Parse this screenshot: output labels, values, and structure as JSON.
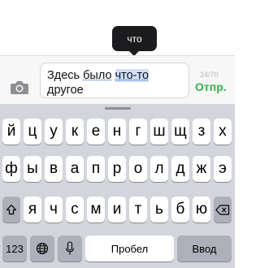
{
  "tooltip": {
    "text": "что"
  },
  "composer": {
    "message": {
      "part1": "Здесь ",
      "underlined_word": "было",
      "space": " ",
      "selected_word": "что-то",
      "line2": "другое"
    },
    "char_count": "24/70",
    "send_label": "Отпр."
  },
  "keyboard": {
    "row1": [
      "й",
      "ц",
      "у",
      "к",
      "е",
      "н",
      "г",
      "ш",
      "щ",
      "з",
      "х"
    ],
    "row2": [
      "ф",
      "ы",
      "в",
      "а",
      "п",
      "р",
      "о",
      "л",
      "д",
      "ж",
      "э"
    ],
    "row3": [
      "я",
      "ч",
      "с",
      "м",
      "и",
      "т",
      "ь",
      "б",
      "ю"
    ],
    "num_label": "123",
    "space_label": "Пробел",
    "return_label": "Ввод",
    "icons": [
      "shift-icon",
      "backspace-icon",
      "globe-icon",
      "microphone-icon",
      "camera-icon"
    ]
  },
  "colors": {
    "send": "#35b24a",
    "selection": "#cfe0fb",
    "keyboard_bg": "#d2d5db",
    "dark_key": "#abb0ba"
  }
}
